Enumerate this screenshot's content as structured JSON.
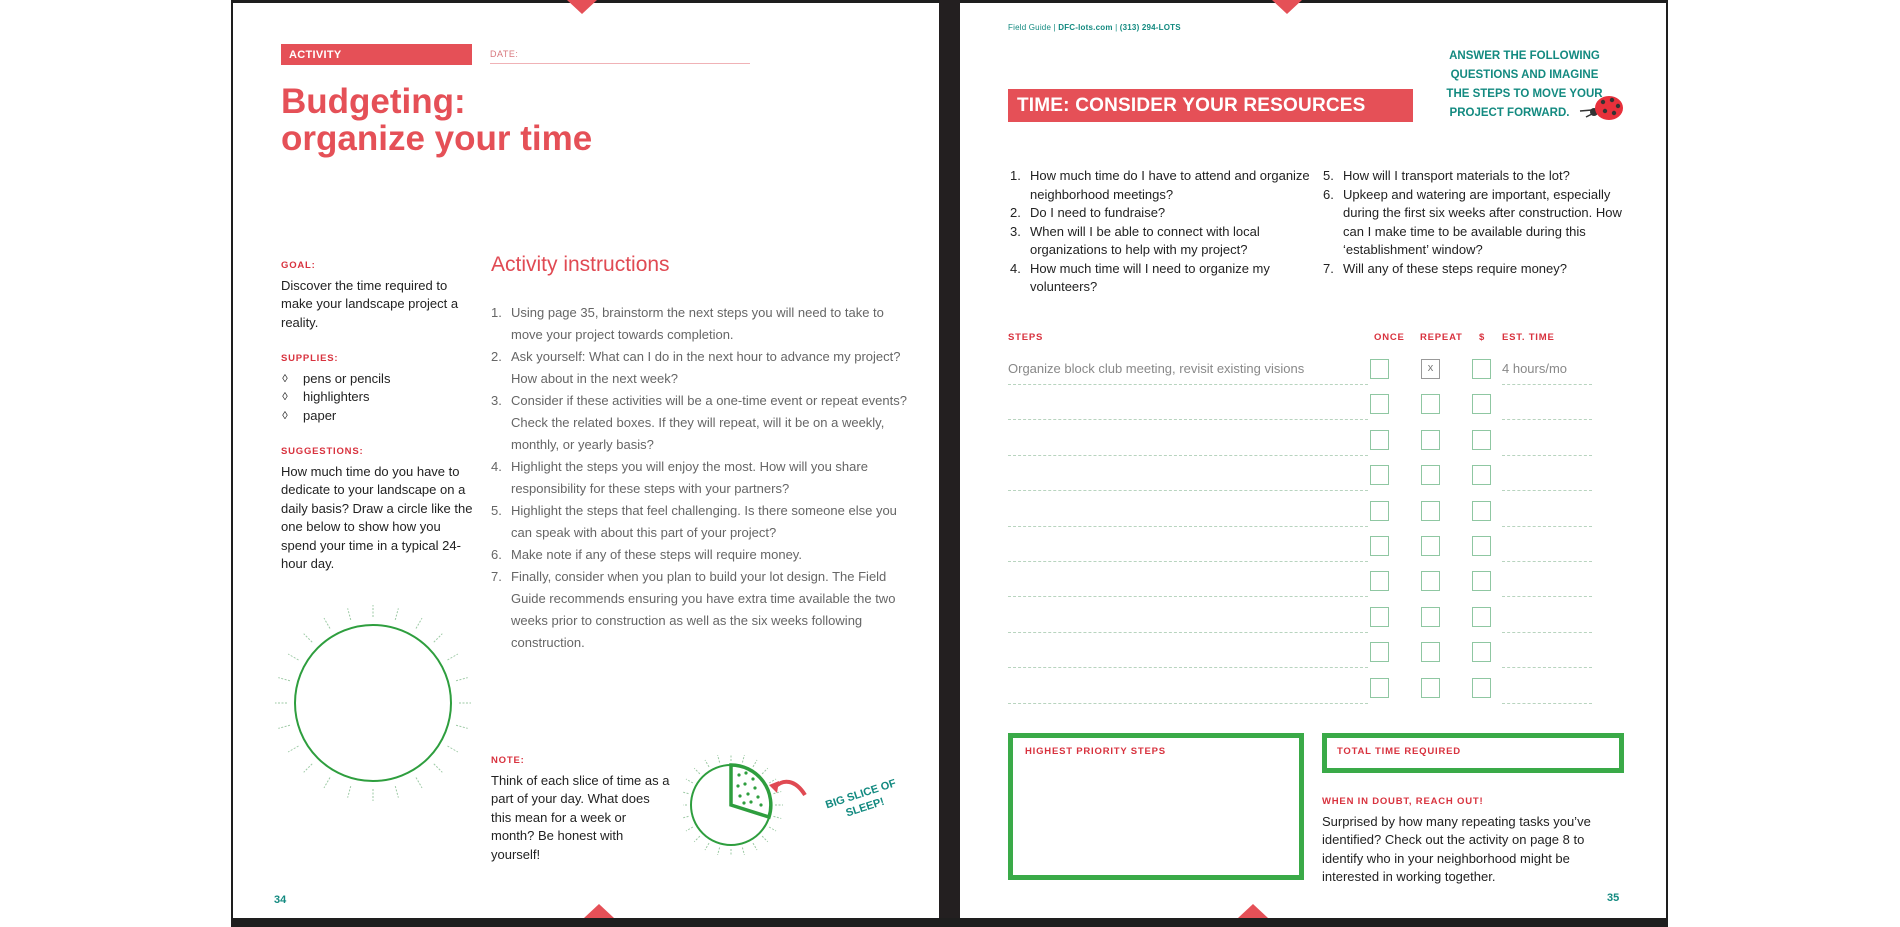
{
  "left_page": {
    "activity_label": "ACTIVITY",
    "date_label": "DATE:",
    "title_line1": "Budgeting:",
    "title_line2": "organize your time",
    "goal": {
      "label": "GOAL:",
      "text": "Discover the time required to make your landscape project a reality."
    },
    "supplies": {
      "label": "SUPPLIES:",
      "bullet": "◊",
      "items": [
        "pens or pencils",
        "highlighters",
        "paper"
      ]
    },
    "suggestions": {
      "label": "SUGGESTIONS:",
      "text": "How much time do you have to dedicate to your landscape on a daily basis? Draw a circle like the one below to show how you spend your time in a typical 24-hour day."
    },
    "instructions": {
      "heading": "Activity instructions",
      "steps": [
        {
          "num": "1.",
          "text": "Using page 35, brainstorm the next steps you will need to take to move your project towards completion."
        },
        {
          "num": "2.",
          "text": "Ask yourself: What can I do in the next hour to advance my project? How about in the next week?"
        },
        {
          "num": "3.",
          "text": "Consider if these activities will be a one-time event or repeat events? Check the related boxes. If they will repeat, will it be on a weekly, monthly, or yearly basis?"
        },
        {
          "num": "4.",
          "text": "Highlight the steps you will enjoy the most. How will you share responsibility for these steps with your partners?"
        },
        {
          "num": "5.",
          "text": "Highlight the steps that feel challenging. Is there someone else you can speak with about this part of your project?"
        },
        {
          "num": "6.",
          "text": "Make note if any of these steps will require money."
        },
        {
          "num": "7.",
          "text": "Finally, consider when you plan to build your lot design. The Field Guide recommends ensuring you have extra time available the two weeks prior to construction as well as the six weeks following construction."
        }
      ]
    },
    "note": {
      "label": "NOTE:",
      "text": "Think of each slice of time as a part of your day. What does this mean for a week or month? Be honest with yourself!"
    },
    "sleep_callout_line1": "BIG SLICE OF",
    "sleep_callout_line2": "SLEEP!",
    "page_number": "34"
  },
  "right_page": {
    "header_prefix": "Field Guide | ",
    "header_site": "DFC-lots.com",
    "header_sep": " | ",
    "header_phone": "(313) 294-LOTS",
    "title": "TIME: CONSIDER YOUR RESOURCES",
    "callout_lines": [
      "ANSWER THE FOLLOWING",
      "QUESTIONS AND IMAGINE",
      "THE STEPS TO MOVE YOUR",
      "PROJECT FORWARD."
    ],
    "questions_left": [
      {
        "num": "1.",
        "text": "How much time do I have to attend and organize neighborhood meetings?"
      },
      {
        "num": "2.",
        "text": "Do I need to fundraise?"
      },
      {
        "num": "3.",
        "text": "When will I be able to connect with local organizations to help with my project?"
      },
      {
        "num": "4.",
        "text": "How much time will I need to organize my volunteers?"
      }
    ],
    "questions_right": [
      {
        "num": "5.",
        "text": "How will I transport materials to the lot?"
      },
      {
        "num": "6.",
        "text": "Upkeep and watering are important, especially during the first six weeks after construction. How can I make time to be available during this ‘establishment’ window?"
      },
      {
        "num": "7.",
        "text": "Will any of these steps require money?"
      }
    ],
    "table": {
      "headers": {
        "steps": "STEPS",
        "once": "ONCE",
        "repeat": "REPEAT",
        "money": "$",
        "est_time": "EST. TIME"
      },
      "rows": [
        {
          "step": "Organize block club meeting, revisit existing visions",
          "once": false,
          "repeat": true,
          "money": false,
          "est_time": "4 hours/mo"
        },
        {
          "step": "",
          "once": false,
          "repeat": false,
          "money": false,
          "est_time": ""
        },
        {
          "step": "",
          "once": false,
          "repeat": false,
          "money": false,
          "est_time": ""
        },
        {
          "step": "",
          "once": false,
          "repeat": false,
          "money": false,
          "est_time": ""
        },
        {
          "step": "",
          "once": false,
          "repeat": false,
          "money": false,
          "est_time": ""
        },
        {
          "step": "",
          "once": false,
          "repeat": false,
          "money": false,
          "est_time": ""
        },
        {
          "step": "",
          "once": false,
          "repeat": false,
          "money": false,
          "est_time": ""
        },
        {
          "step": "",
          "once": false,
          "repeat": false,
          "money": false,
          "est_time": ""
        },
        {
          "step": "",
          "once": false,
          "repeat": false,
          "money": false,
          "est_time": ""
        },
        {
          "step": "",
          "once": false,
          "repeat": false,
          "money": false,
          "est_time": ""
        }
      ],
      "check_mark": "x"
    },
    "priority_box_label": "HIGHEST PRIORITY STEPS",
    "total_box_label": "TOTAL TIME REQUIRED",
    "reach_out": {
      "label": "WHEN IN DOUBT, REACH OUT!",
      "text": "Surprised by how many repeating tasks you’ve identified? Check out the activity on page 8 to identify who in your neighborhood might be interested in working together."
    },
    "page_number": "35"
  },
  "colors": {
    "accent_red": "#e55057",
    "label_red": "#d8323e",
    "teal": "#138a80",
    "green": "#3aaa48",
    "gutter": "#231f20"
  }
}
